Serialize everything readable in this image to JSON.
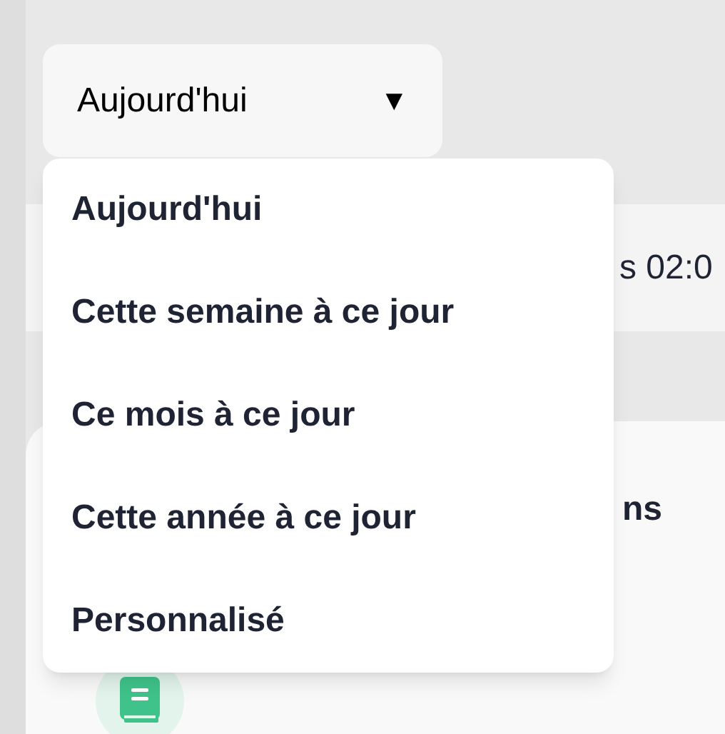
{
  "period_dropdown": {
    "value": "Aujourd'hui",
    "arrow": "▼"
  },
  "period_menu": [
    {
      "label": "Aujourd'hui"
    },
    {
      "label": "Cette semaine à ce jour"
    },
    {
      "label": "Ce mois à ce jour"
    },
    {
      "label": "Cette année à ce jour"
    },
    {
      "label": "Personnalisé"
    }
  ],
  "info_bar": {
    "text": "s 02:0"
  },
  "card": {
    "title": "ns"
  }
}
